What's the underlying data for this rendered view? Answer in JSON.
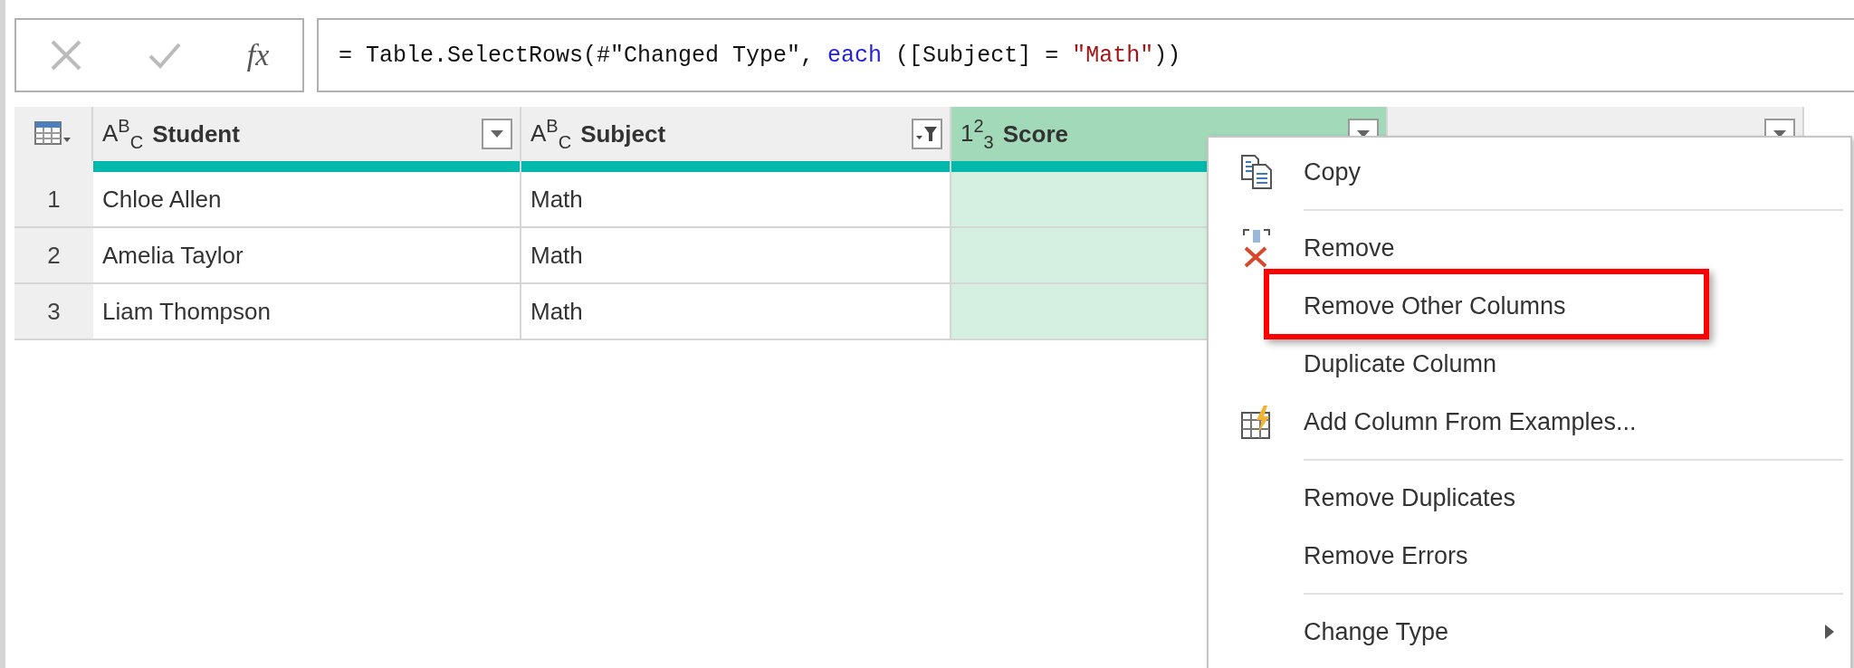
{
  "formula_bar": {
    "function_label": "fx",
    "formula": [
      {
        "kind": "plain",
        "text": "= Table.SelectRows(#\"Changed Type\", "
      },
      {
        "kind": "keyword",
        "text": "each"
      },
      {
        "kind": "plain",
        "text": " ([Subject] = "
      },
      {
        "kind": "string",
        "text": "\"Math\""
      },
      {
        "kind": "plain",
        "text": "))"
      }
    ]
  },
  "table": {
    "columns": [
      {
        "name": "Student",
        "type_icon": "A$^{B}$$_{C}$",
        "filtered": false,
        "selected": false
      },
      {
        "name": "Subject",
        "type_icon": "A$^{B}$$_{C}$",
        "filtered": true,
        "selected": false
      },
      {
        "name": "Score",
        "type_icon": "1$^{2}$$_{3}$",
        "filtered": false,
        "selected": true
      },
      {
        "filtered": false,
        "selected": false
      }
    ],
    "rows": [
      {
        "number": "1",
        "cells": [
          "Chloe Allen",
          "Math"
        ]
      },
      {
        "number": "2",
        "cells": [
          "Amelia Taylor",
          "Math"
        ]
      },
      {
        "number": "3",
        "cells": [
          "Liam Thompson",
          "Math"
        ]
      }
    ]
  },
  "context_menu": {
    "items": [
      {
        "kind": "copy",
        "label": "Copy",
        "submenu": false,
        "annotated": false
      },
      {
        "kind": "separator"
      },
      {
        "kind": "remove",
        "label": "Remove",
        "submenu": false,
        "annotated": false
      },
      {
        "kind": "item",
        "label": "Remove Other Columns",
        "submenu": false,
        "annotated": true
      },
      {
        "kind": "item",
        "label": "Duplicate Column",
        "submenu": false,
        "annotated": false
      },
      {
        "kind": "examples",
        "label": "Add Column From Examples...",
        "submenu": false,
        "annotated": false
      },
      {
        "kind": "separator"
      },
      {
        "kind": "item",
        "label": "Remove Duplicates",
        "submenu": false,
        "annotated": false
      },
      {
        "kind": "item",
        "label": "Remove Errors",
        "submenu": false,
        "annotated": false
      },
      {
        "kind": "separator"
      },
      {
        "kind": "item",
        "label": "Change Type",
        "submenu": true,
        "annotated": false
      }
    ]
  }
}
